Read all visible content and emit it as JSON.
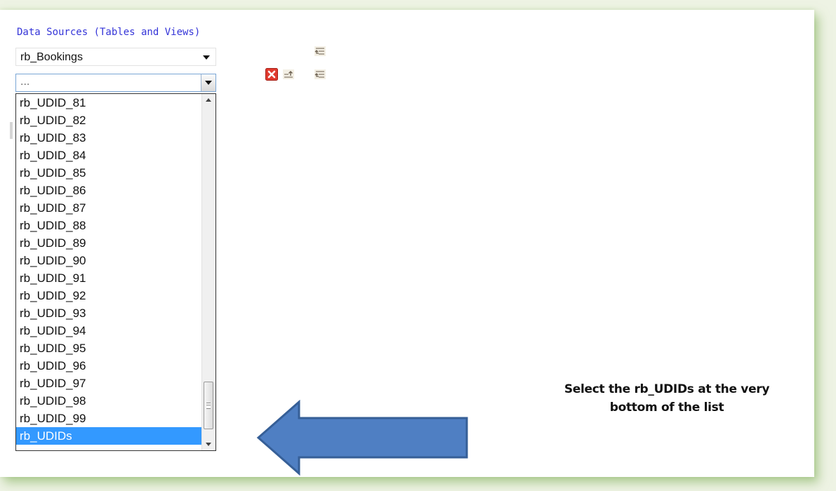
{
  "data_sources": {
    "label": "Data Sources (Tables and Views)",
    "primary_select_value": "rb_Bookings",
    "secondary_select_value": "...",
    "options": [
      "rb_UDID_81",
      "rb_UDID_82",
      "rb_UDID_83",
      "rb_UDID_84",
      "rb_UDID_85",
      "rb_UDID_86",
      "rb_UDID_87",
      "rb_UDID_88",
      "rb_UDID_89",
      "rb_UDID_90",
      "rb_UDID_91",
      "rb_UDID_92",
      "rb_UDID_93",
      "rb_UDID_94",
      "rb_UDID_95",
      "rb_UDID_96",
      "rb_UDID_97",
      "rb_UDID_98",
      "rb_UDID_99",
      "rb_UDIDs"
    ],
    "selected_option": "rb_UDIDs"
  },
  "icons": {
    "join_1": "join-icon",
    "remove": "remove-icon",
    "move_up": "move-up-icon",
    "join_2": "join-icon"
  },
  "callout": {
    "line1": "Select the rb_UDIDs at the very",
    "line2": "bottom of the list"
  },
  "colors": {
    "label": "#3535d8",
    "selection": "#3399ff",
    "arrow_fill": "#4f7fc3",
    "arrow_stroke": "#365f97",
    "remove_red": "#e03a2e"
  }
}
